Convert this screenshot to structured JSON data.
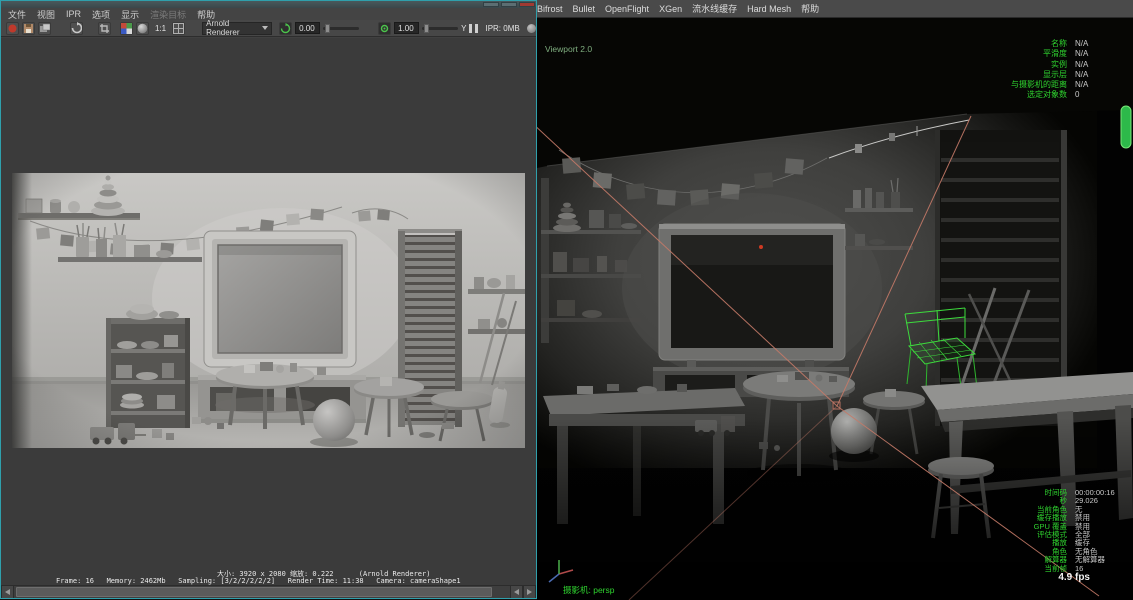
{
  "left_window": {
    "menus": [
      {
        "label": "文件"
      },
      {
        "label": "视图"
      },
      {
        "label": "IPR"
      },
      {
        "label": "选项"
      },
      {
        "label": "显示"
      },
      {
        "label": "渲染目标"
      },
      {
        "label": "帮助"
      }
    ],
    "toolbar": {
      "scale_label": "1:1",
      "renderer": "Arnold Renderer",
      "exposure": "0.00",
      "gamma": "1.00",
      "axis": "Y",
      "ipr_memory": "IPR: 0MB"
    },
    "status_line1": "大小: 3920 x 2080 缩放: 0.222      (Arnold Renderer)",
    "status_line2": "Frame: 16   Memory: 2462Mb   Sampling: [3/2/2/2/2/2]   Render Time: 11:38   Camera: cameraShape1"
  },
  "maya": {
    "menus": [
      {
        "label": "Bifrost"
      },
      {
        "label": "Bullet"
      },
      {
        "label": "OpenFlight"
      },
      {
        "label": "XGen"
      },
      {
        "label": "流水线缓存"
      },
      {
        "label": "Hard Mesh"
      },
      {
        "label": "帮助"
      }
    ],
    "renderer_label": "Viewport 2.0",
    "camera_label": "摄影机: persp",
    "fps": "4.9 fps",
    "hud_object_details": [
      {
        "label": "名称",
        "value": "N/A"
      },
      {
        "label": "平滑度",
        "value": "N/A"
      },
      {
        "label": "实例",
        "value": "N/A"
      },
      {
        "label": "显示层",
        "value": "N/A"
      },
      {
        "label": "与摄影机的距离",
        "value": "N/A"
      },
      {
        "label": "选定对象数",
        "value": "0"
      }
    ],
    "hud_playback": [
      {
        "label": "时间码",
        "value": "00:00:00:16"
      },
      {
        "label": "秒",
        "value": "29.026"
      },
      {
        "label": "当前角色",
        "value": "无"
      },
      {
        "label": "缓存播放",
        "value": "禁用"
      },
      {
        "label": "GPU 覆盖",
        "value": "禁用"
      },
      {
        "label": "评估模式",
        "value": "全部"
      },
      {
        "label": "播放",
        "value": "缓存"
      },
      {
        "label": "角色",
        "value": "无角色"
      },
      {
        "label": "解算器",
        "value": "无解算器"
      },
      {
        "label": "当前帧",
        "value": "16"
      }
    ]
  },
  "icons": {
    "record": "red-dot",
    "save": "floppy",
    "snapshot": "overlapping-frames",
    "render-refresh": "circular-arrow",
    "crop": "crop-corners",
    "rgba-channels": "four-color-grid",
    "display-sphere": "gray-sphere",
    "aov-grid": "grid",
    "start-ipr": "green-circular-arrow",
    "white-balance": "green-target",
    "pause": "double-bar",
    "status-indicator": "gray-dot"
  }
}
